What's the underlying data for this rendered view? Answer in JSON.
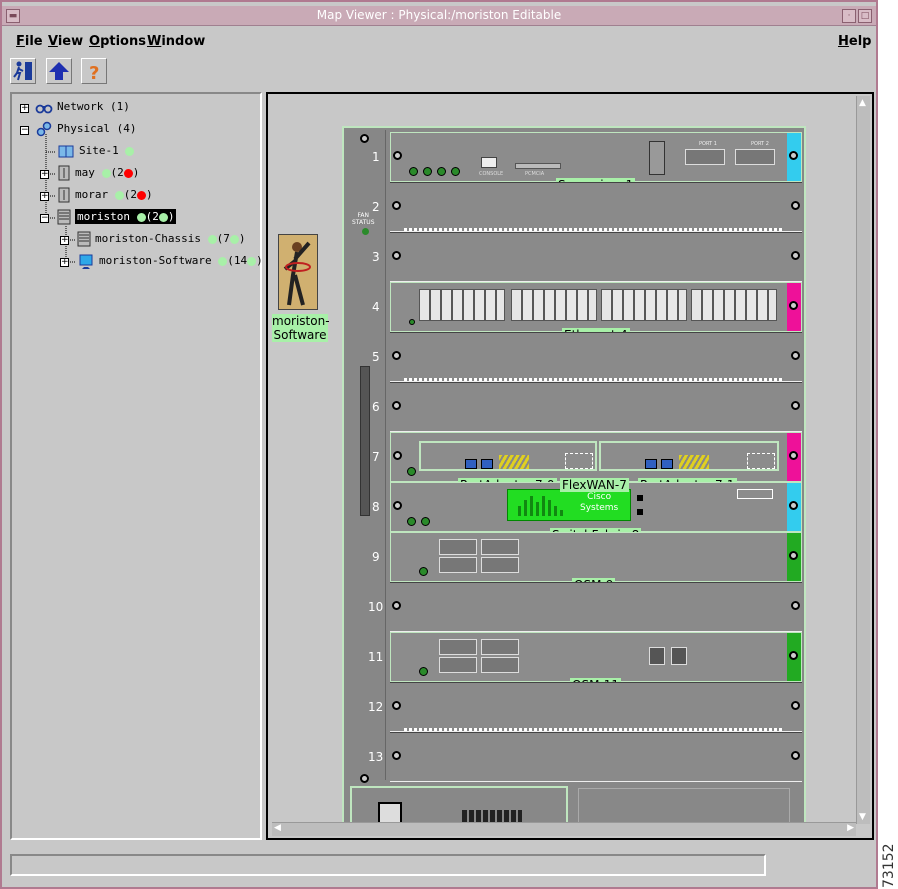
{
  "window": {
    "title": "Map Viewer : Physical:/moriston    Editable"
  },
  "menubar": {
    "file": "File",
    "view": "View",
    "options": "Options",
    "window": "Window",
    "help": "Help"
  },
  "toolbar": {
    "items": [
      {
        "icon": "exit-icon"
      },
      {
        "icon": "up-arrow-icon"
      },
      {
        "icon": "help-question-icon"
      }
    ]
  },
  "tree": {
    "nodes": [
      {
        "label": "Network",
        "count": "(1)"
      },
      {
        "label": "Physical",
        "count": "(4)"
      },
      {
        "label": "Site-1"
      },
      {
        "label": "may",
        "count": "(2"
      },
      {
        "label": "morar",
        "count": "(2"
      },
      {
        "label": "moriston",
        "count": "(2"
      },
      {
        "label": "moriston-Chassis",
        "count": "(7"
      },
      {
        "label": "moriston-Software",
        "count": "(14"
      }
    ]
  },
  "map": {
    "software_label": "moriston-\nSoftware",
    "fan_status": "FAN\nSTATUS",
    "slots": [
      "1",
      "2",
      "3",
      "4",
      "5",
      "6",
      "7",
      "8",
      "9",
      "10",
      "11",
      "12",
      "13"
    ],
    "cards": {
      "supervisor": "Supervisor-1",
      "ethernet": "Ethernet-4",
      "pa0": "PortAdapter-7-0",
      "flexwan": "FlexWAN-7",
      "pa1": "PortAdapter-7-1",
      "switchfabric": "SwitchFabric-8",
      "osm9": "OSM-9",
      "osm11": "OSM-11"
    },
    "supervisor_ports": {
      "port1": "PORT 1",
      "port2": "PORT 2",
      "console": "CONSOLE",
      "pcmcia": "PCMCIA"
    },
    "cisco_logo": "Cisco\nSystems"
  },
  "figure_id": "73152",
  "colors": {
    "title_bg": "#c9aab6",
    "label_bg": "#a8f0a8",
    "status_green": "#a8f0a8",
    "status_red": "#ff0000",
    "handle_cyan": "#33ccee",
    "handle_magenta": "#ee1199",
    "handle_green": "#22aa22"
  }
}
